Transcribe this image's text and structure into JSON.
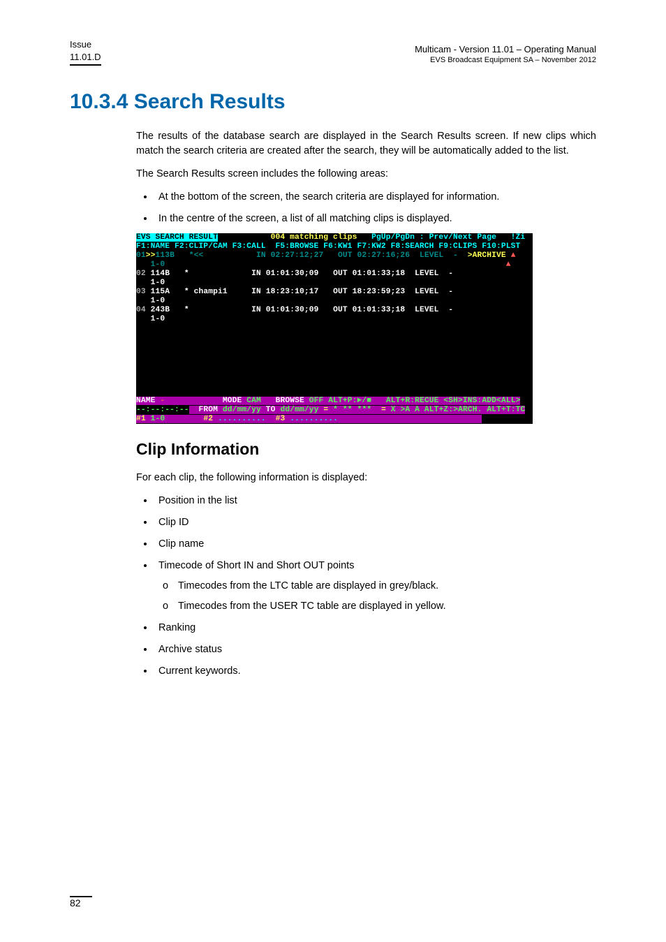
{
  "header": {
    "issue_label": "Issue",
    "issue_value": "11.01.D",
    "right_line1": "Multicam - Version 11.01 – Operating Manual",
    "right_line2": "EVS Broadcast Equipment SA – November 2012"
  },
  "section_heading": "10.3.4 Search  Results",
  "intro_para1": "The results of the database search are displayed in the Search Results screen. If new clips which match the search criteria are created after the search, they will be automatically added to the list.",
  "intro_para2": "The Search Results screen includes the following areas:",
  "intro_bullets": [
    "At the bottom of the screen, the search criteria are displayed for information.",
    "In the centre of the screen, a list of all matching clips is displayed."
  ],
  "terminal": {
    "title_left": "EVS SEARCH RESULT",
    "title_mid": "004 matching clips",
    "title_right": "PgUp/PgDn : Prev/Next Page   !Zi",
    "fkeys": "F1:NAME F2:CLIP/CAM F3:CALL  F5:BROWSE F6:KW1 F7:KW2 F8:SEARCH F9:CLIPS F10:PLST",
    "rows": [
      {
        "pos": "01",
        "sel": ">>",
        "id": "113B",
        "sub": "1-0",
        "name": "*<<",
        "in": "IN 02:27:12;27",
        "out": "OUT 02:27:16;26",
        "level": "LEVEL  -",
        "extra": ">ARCHIVE"
      },
      {
        "pos": "02",
        "sel": "",
        "id": "114B",
        "sub": "1-0",
        "name": "*",
        "in": "IN 01:01:30;09",
        "out": "OUT 01:01:33;18",
        "level": "LEVEL  -",
        "extra": ""
      },
      {
        "pos": "03",
        "sel": "",
        "id": "115A",
        "sub": "1-0",
        "name": "* champi1",
        "in": "IN 18:23:10;17",
        "out": "OUT 18:23:59;23",
        "level": "LEVEL  -",
        "extra": ""
      },
      {
        "pos": "04",
        "sel": "",
        "id": "243B",
        "sub": "1-0",
        "name": "*",
        "in": "IN 01:01:30;09",
        "out": "OUT 01:01:33;18",
        "level": "LEVEL  -",
        "extra": ""
      }
    ],
    "footer_line1_a": "NAME",
    "footer_line1_b": "-",
    "footer_line1_c": "MODE",
    "footer_line1_d": "CAM",
    "footer_line1_e": "BROWSE",
    "footer_line1_f": "OFF",
    "footer_line1_g": "ALT+P:►/■",
    "footer_line1_h": "ALT+R:RECUE <SH>INS:ADD<ALL>",
    "footer_line2_a": "--:--:--:--",
    "footer_line2_b": "FROM",
    "footer_line2_c": "dd/mm/yy",
    "footer_line2_d": "TO",
    "footer_line2_e": "dd/mm/yy",
    "footer_line2_f": "=",
    "footer_line2_g": "* ** ***",
    "footer_line2_h": "=",
    "footer_line2_i": "X >A A ALT+Z:>ARCH. ALT+T:TC",
    "footer_line3_a": "#1",
    "footer_line3_b": "1-0",
    "footer_line3_c": "#2",
    "footer_line3_d": "..........",
    "footer_line3_e": "#3",
    "footer_line3_f": ".........."
  },
  "clip_info_heading": "Clip  Information",
  "clip_info_intro": "For each clip, the following information is displayed:",
  "clip_info_items": [
    {
      "text": "Position in the list",
      "subs": []
    },
    {
      "text": "Clip ID",
      "subs": []
    },
    {
      "text": "Clip name",
      "subs": []
    },
    {
      "text": "Timecode of Short IN and Short OUT points",
      "subs": [
        "Timecodes from the LTC table are displayed in grey/black.",
        "Timecodes from the USER TC table are displayed in yellow."
      ]
    },
    {
      "text": "Ranking",
      "subs": []
    },
    {
      "text": "Archive status",
      "subs": []
    },
    {
      "text": "Current keywords.",
      "subs": []
    }
  ],
  "page_number": "82"
}
